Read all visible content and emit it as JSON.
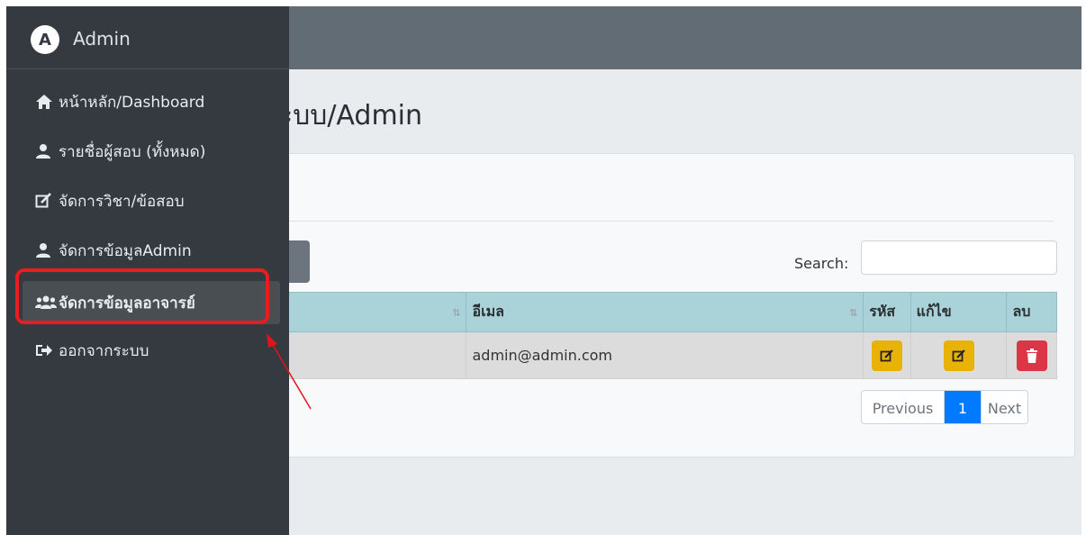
{
  "brand": {
    "logo_letter": "A",
    "name": "Admin"
  },
  "page": {
    "title": "ระบบ/Admin"
  },
  "sidebar": {
    "items": [
      {
        "label": "หน้าหลัก/Dashboard",
        "icon": "home-icon"
      },
      {
        "label": "รายชื่อผู้สอบ (ทั้งหมด)",
        "icon": "user-icon"
      },
      {
        "label": "จัดการวิชา/ข้อสอบ",
        "icon": "edit-icon"
      },
      {
        "label": "จัดการข้อมูลAdmin",
        "icon": "user-icon"
      },
      {
        "label": "จัดการข้อมูลอาจารย์",
        "icon": "users-icon",
        "active": true
      },
      {
        "label": "ออกจากระบบ",
        "icon": "sign-out-icon"
      }
    ]
  },
  "table": {
    "search_label": "Search:",
    "search_value": "",
    "columns": [
      "",
      "อีเมล",
      "รหัส",
      "แก้ไข",
      "ลบ"
    ],
    "rows": [
      {
        "name": "",
        "email": "admin@admin.com"
      }
    ]
  },
  "pagination": {
    "previous": "Previous",
    "current": "1",
    "next": "Next"
  },
  "colors": {
    "sidebar_bg": "#343a40",
    "header_bg": "#a9d3d8",
    "warning": "#e9b207",
    "danger": "#dc3545",
    "primary": "#007bff",
    "highlight": "#ea1c1c"
  }
}
